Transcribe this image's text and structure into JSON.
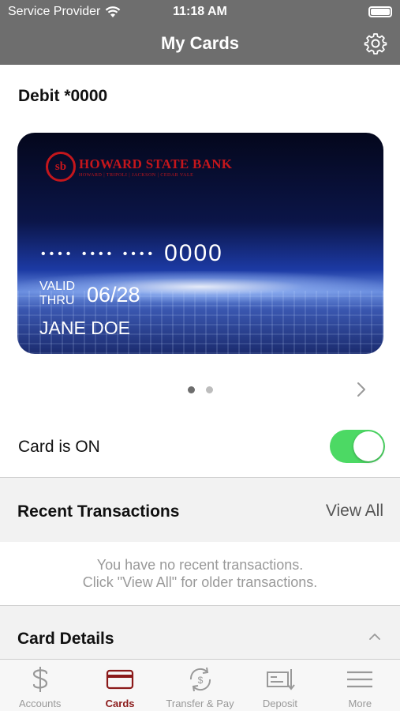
{
  "status_bar": {
    "carrier": "Service Provider",
    "time": "11:18 AM"
  },
  "nav": {
    "title": "My Cards"
  },
  "card": {
    "title": "Debit *0000",
    "bank_name": "HOWARD STATE BANK",
    "bank_subtitle": "HOWARD | TRIPOLI | JACKSON | CEDAR VALE",
    "logo_mark": "sb",
    "masked_groups": "•••• •••• ••••",
    "last_four": "0000",
    "valid_line1": "VALID",
    "valid_line2": "THRU",
    "expiry": "06/28",
    "holder": "JANE DOE"
  },
  "pager": {
    "count": 2,
    "active_index": 0
  },
  "card_status": {
    "label": "Card is ON",
    "on": true
  },
  "recent_transactions": {
    "title": "Recent Transactions",
    "view_all": "View All",
    "empty_line1": "You have no recent transactions.",
    "empty_line2": "Click \"View All\" for older transactions."
  },
  "card_details": {
    "title": "Card Details"
  },
  "tabs": [
    {
      "label": "Accounts",
      "icon": "dollar-icon",
      "active": false
    },
    {
      "label": "Cards",
      "icon": "card-icon",
      "active": true
    },
    {
      "label": "Transfer & Pay",
      "icon": "transfer-icon",
      "active": false
    },
    {
      "label": "Deposit",
      "icon": "check-deposit-icon",
      "active": false
    },
    {
      "label": "More",
      "icon": "menu-icon",
      "active": false
    }
  ],
  "colors": {
    "header_bg": "#6e6e6e",
    "toggle_on": "#4cd964",
    "active_tab": "#8b1a1a",
    "bank_red": "#c4161c"
  }
}
